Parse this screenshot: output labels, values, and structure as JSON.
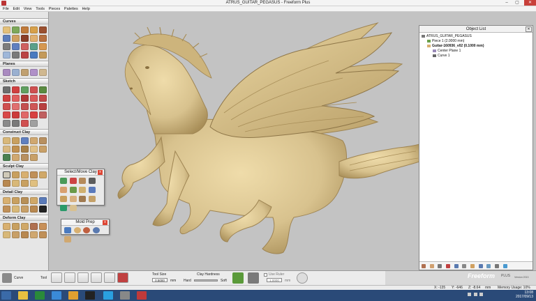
{
  "window": {
    "title": "ATRUS_GUITAR_PEGASUS - Freeform Plus"
  },
  "menu": [
    "File",
    "Edit",
    "View",
    "Tools",
    "Pieces",
    "Palettes",
    "Help"
  ],
  "palettes": {
    "curves": "Curves",
    "planes": "Planes",
    "sketch": "Sketch",
    "construct_clay": "Construct Clay",
    "sculpt_clay": "Sculpt Clay",
    "detail_clay": "Detail Clay",
    "deform_clay": "Deform Clay"
  },
  "floating": {
    "select_move_clay": "Select/Move Clay",
    "mold_prep": "Mold Prep",
    "close_glyph": "x"
  },
  "object_list": {
    "title": "Object List",
    "items": [
      {
        "label": "ATRUS_GUITAR_PEGASUS",
        "level": 0
      },
      {
        "label": "Piece 1 (2.0000 mm)",
        "level": 1
      },
      {
        "label": "Guitar-160936_v02 (0.1000 mm)",
        "level": 1,
        "bold": true
      },
      {
        "label": "Center Plane 1",
        "level": 2
      },
      {
        "label": "Curve 1",
        "level": 2
      }
    ]
  },
  "toolbar": {
    "current_tool": "Curve",
    "tool_label": "Tool",
    "tool_size_label": "Tool Size",
    "tool_size_value": "0.5000",
    "tool_size_unit": "mm",
    "clay_hardness_label": "Clay Hardness",
    "hard_label": "Hard",
    "soft_label": "Soft",
    "use_ruler_label": "Use Ruler",
    "ruler_value": "1.0000",
    "ruler_unit": "mm"
  },
  "brand": {
    "name": "Freeform",
    "edition": "PLUS",
    "version": "Version 2013"
  },
  "status": {
    "x": "X:  -135",
    "y": "Y:  -646",
    "z": "Z:  -8.64",
    "unit": "mm",
    "memory": "Memory Usage: 10%"
  },
  "taskbar": {
    "time": "13:08",
    "date": "2017/09/13"
  },
  "colors": {
    "clay": "#d8c28e",
    "background": "#c3c3c3",
    "taskbar": "#2a4a78",
    "accent_red": "#d43"
  }
}
